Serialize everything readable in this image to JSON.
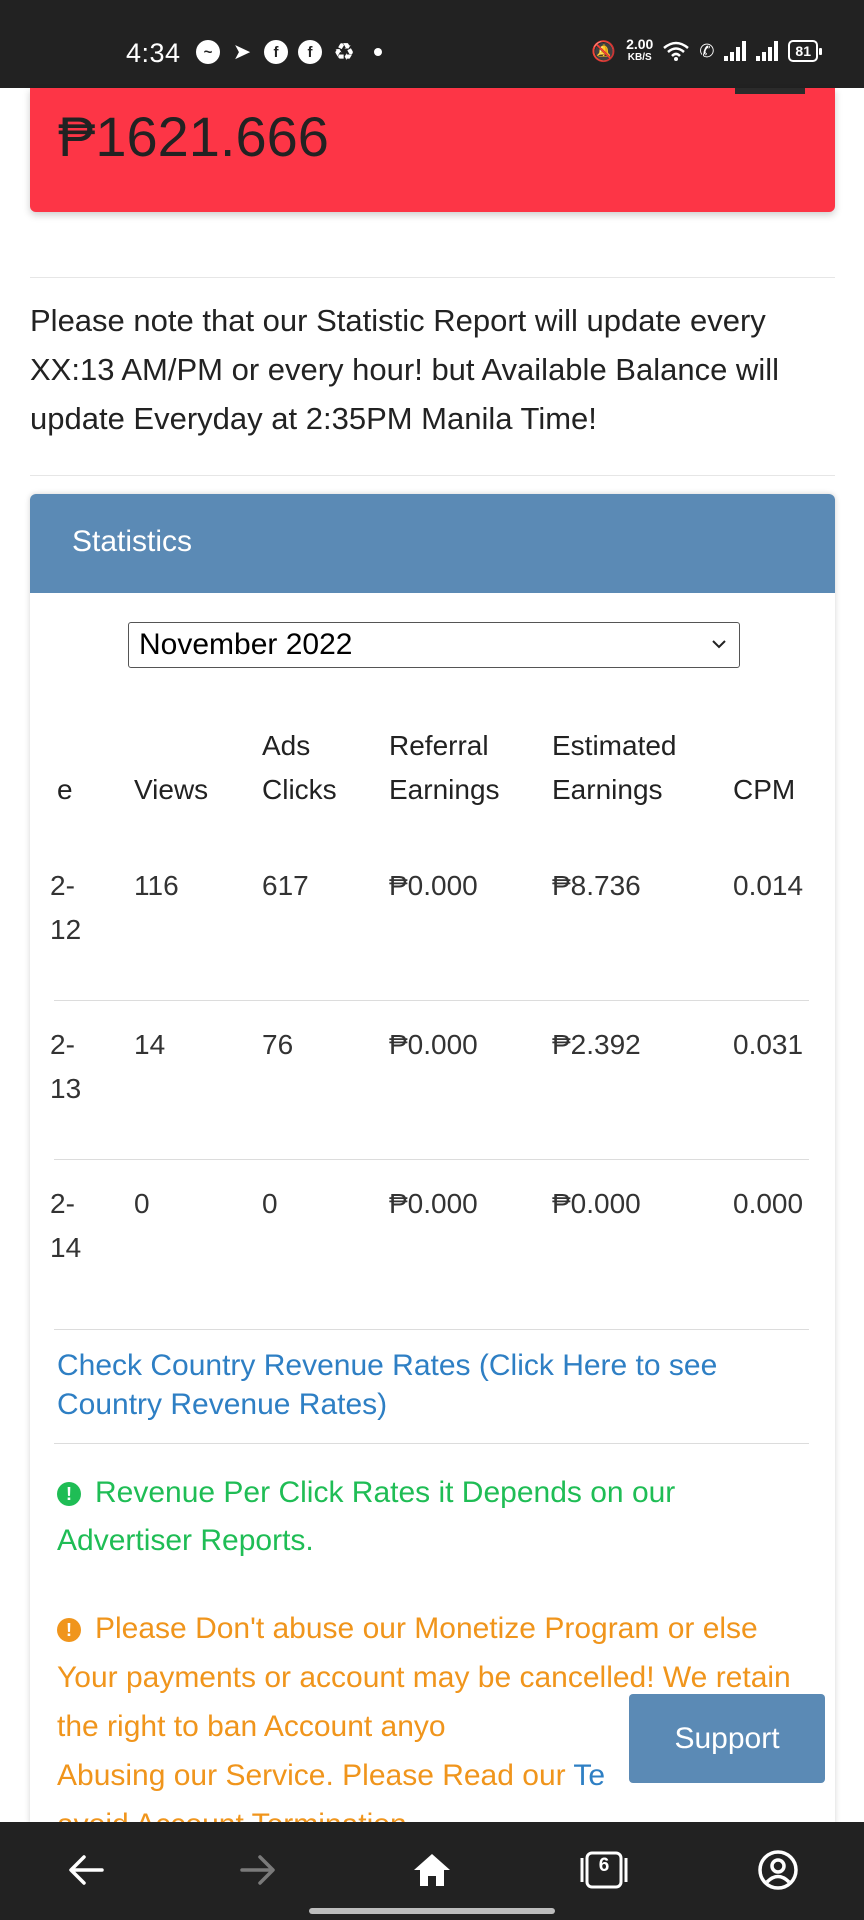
{
  "status_bar": {
    "time": "4:34",
    "net_speed_value": "2.00",
    "net_speed_unit": "KB/S",
    "battery": "81"
  },
  "balance": {
    "amount": "₱1621.666",
    "accent_color": "#fd3546"
  },
  "notice": "Please note that our Statistic Report will update every XX:13 AM/PM or every hour! but Available Balance will update Everyday at 2:35PM Manila Time!",
  "statistics": {
    "title": "Statistics",
    "header_color": "#5b8ab5",
    "month_select": "November 2022",
    "columns": {
      "date": "e",
      "views": "Views",
      "ads_clicks_1": "Ads",
      "ads_clicks_2": "Clicks",
      "referral_1": "Referral",
      "referral_2": "Earnings",
      "estimated_1": "Estimated",
      "estimated_2": "Earnings",
      "cpm": "CPM"
    },
    "rows": [
      {
        "date_1": "2-",
        "date_2": "12",
        "views": "116",
        "ads_clicks": "617",
        "referral": "₱0.000",
        "estimated": "₱8.736",
        "cpm": "0.014"
      },
      {
        "date_1": "2-",
        "date_2": "13",
        "views": "14",
        "ads_clicks": "76",
        "referral": "₱0.000",
        "estimated": "₱2.392",
        "cpm": "0.031"
      },
      {
        "date_1": "2-",
        "date_2": "14",
        "views": "0",
        "ads_clicks": "0",
        "referral": "₱0.000",
        "estimated": "₱0.000",
        "cpm": "0.000"
      }
    ],
    "country_link": "Check Country Revenue Rates (Click Here to see Country Revenue Rates)",
    "success_msg": "Revenue Per Click Rates it Depends on our Advertiser Reports.",
    "warning_msg": "Please Don't abuse our Monetize Program or else Your payments or account may be cancelled! We retain the right to ban Account anyo",
    "warning_msg_2": "Abusing our Service. Please Read our",
    "warning_link": "Te",
    "warning_msg_3": "avoid Account Termination"
  },
  "support_button": "Support",
  "icons": [
    "back-arrow-icon",
    "forward-arrow-icon",
    "home-icon",
    "tabs-icon",
    "account-icon"
  ],
  "tab_count": "6"
}
